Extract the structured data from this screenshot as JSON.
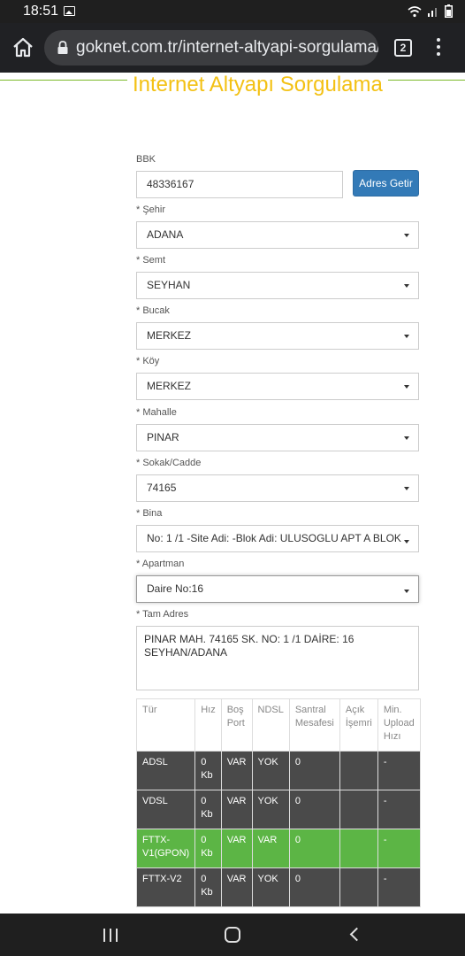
{
  "status_bar": {
    "time": "18:51"
  },
  "browser": {
    "url": "goknet.com.tr/internet-altyapi-sorgulama/",
    "tab_count": "2"
  },
  "page": {
    "title": "Internet Altyapı Sorgulama"
  },
  "form": {
    "bbk_label": "BBK",
    "bbk_value": "48336167",
    "adres_getir_label": "Adres Getir",
    "sehir_label": "* Şehir",
    "sehir_value": "ADANA",
    "semt_label": "* Semt",
    "semt_value": "SEYHAN",
    "bucak_label": "* Bucak",
    "bucak_value": "MERKEZ",
    "koy_label": "* Köy",
    "koy_value": "MERKEZ",
    "mahalle_label": "* Mahalle",
    "mahalle_value": "PINAR",
    "sokak_label": "* Sokak/Cadde",
    "sokak_value": "74165",
    "bina_label": "* Bina",
    "bina_value": "No: 1 /1 -Site Adi: -Blok Adi: ULUSOGLU APT A BLOK",
    "apartman_label": "* Apartman",
    "apartman_value": "Daire No:16",
    "tam_adres_label": "* Tam Adres",
    "tam_adres_line1": "PINAR MAH. 74165 SK. NO: 1 /1 DAİRE: 16",
    "tam_adres_line2": "SEYHAN/ADANA"
  },
  "table": {
    "headers": {
      "tur": "Tür",
      "hiz": "Hız",
      "bos_port_1": "Boş",
      "bos_port_2": "Port",
      "ndsl": "NDSL",
      "santral_1": "Santral",
      "santral_2": "Mesafesi",
      "acik_1": "Açık",
      "acik_2": "İşemri",
      "min_1": "Min.",
      "min_2": "Upload",
      "min_3": "Hızı"
    },
    "rows": [
      {
        "tur_1": "ADSL",
        "tur_2": "",
        "hiz_1": "0",
        "hiz_2": "Kb",
        "bos_port": "VAR",
        "ndsl": "YOK",
        "santral": "0",
        "acik": "",
        "min_upload": "-"
      },
      {
        "tur_1": "VDSL",
        "tur_2": "",
        "hiz_1": "0",
        "hiz_2": "Kb",
        "bos_port": "VAR",
        "ndsl": "YOK",
        "santral": "0",
        "acik": "",
        "min_upload": "-"
      },
      {
        "tur_1": "FTTX-",
        "tur_2": "V1(GPON)",
        "hiz_1": "0",
        "hiz_2": "Kb",
        "bos_port": "VAR",
        "ndsl": "VAR",
        "santral": "0",
        "acik": "",
        "min_upload": "-"
      },
      {
        "tur_1": "FTTX-V2",
        "tur_2": "",
        "hiz_1": "0",
        "hiz_2": "Kb",
        "bos_port": "VAR",
        "ndsl": "YOK",
        "santral": "0",
        "acik": "",
        "min_upload": "-"
      }
    ]
  },
  "colors": {
    "title": "#f3c114",
    "rule": "#7bb928",
    "button": "#337ab7",
    "row_dark": "#4a4a4a",
    "row_green": "#5cb545"
  },
  "icons": [
    "image-icon",
    "wifi-icon",
    "signal-icon",
    "battery-icon",
    "home-icon",
    "lock-icon",
    "tabs-icon",
    "menu-icon",
    "recent-apps-icon",
    "home-nav-icon",
    "back-icon",
    "dropdown-caret-icon"
  ]
}
